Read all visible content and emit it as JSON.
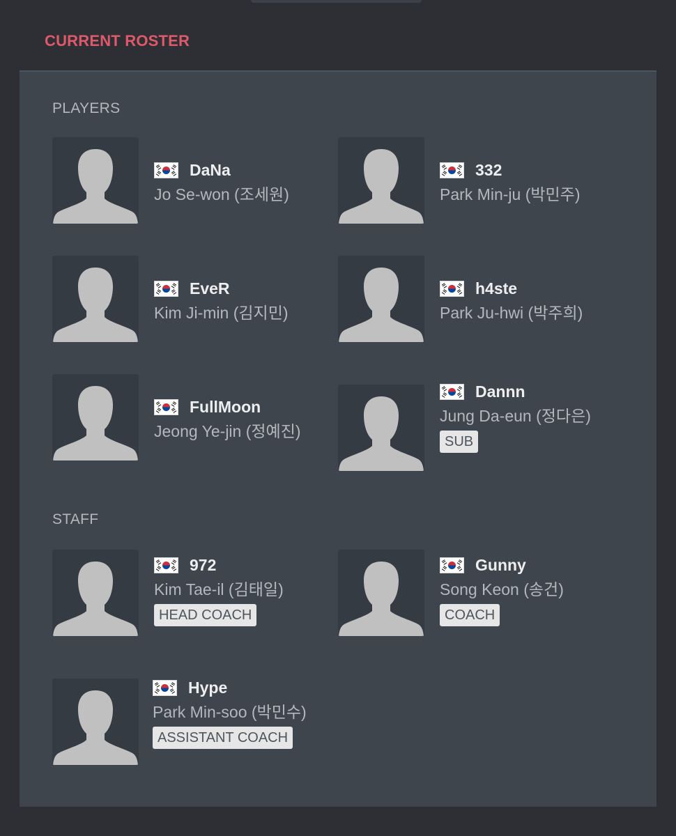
{
  "section": {
    "title": "CURRENT ROSTER"
  },
  "players": {
    "label": "PLAYERS",
    "items": [
      {
        "nick": "DaNa",
        "realname": "Jo Se-won (조세원)",
        "flag": "south-korea-flag",
        "badge": null
      },
      {
        "nick": "332",
        "realname": "Park Min-ju (박민주)",
        "flag": "south-korea-flag",
        "badge": null
      },
      {
        "nick": "EveR",
        "realname": "Kim Ji-min (김지민)",
        "flag": "south-korea-flag",
        "badge": null
      },
      {
        "nick": "h4ste",
        "realname": "Park Ju-hwi (박주희)",
        "flag": "south-korea-flag",
        "badge": null
      },
      {
        "nick": "FullMoon",
        "realname": "Jeong Ye-jin (정예진)",
        "flag": "south-korea-flag",
        "badge": null
      },
      {
        "nick": "Dannn",
        "realname": "Jung Da-eun (정다은)",
        "flag": "south-korea-flag",
        "badge": "SUB"
      }
    ]
  },
  "staff": {
    "label": "STAFF",
    "items": [
      {
        "nick": "972",
        "realname": "Kim Tae-il (김태일)",
        "flag": "south-korea-flag",
        "badge": "HEAD COACH"
      },
      {
        "nick": "Gunny",
        "realname": "Song Keon (송건)",
        "flag": "south-korea-flag",
        "badge": "COACH"
      },
      {
        "nick": "Hype",
        "realname": "Park Min-soo (박민수)",
        "flag": "south-korea-flag",
        "badge": "ASSISTANT COACH"
      }
    ]
  },
  "colors": {
    "page_background": "#2d2f34",
    "panel_background": "#3f454d",
    "heading_accent": "#de5a6a",
    "avatar_background": "#353b43",
    "avatar_silhouette": "#c0c0c0",
    "badge_background": "#e6e6e6"
  },
  "icons": {
    "avatar": "person-silhouette-icon",
    "flag": "south-korea-flag-icon"
  }
}
